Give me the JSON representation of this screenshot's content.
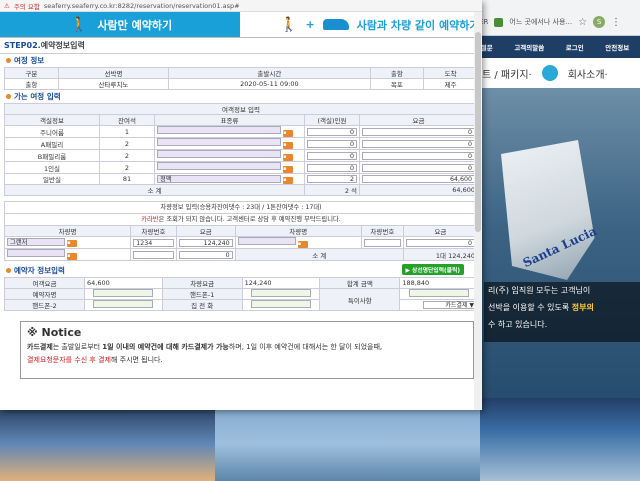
{
  "browser": {
    "warning": "주의 요함",
    "url": "seaferry.seaferry.co.kr:8282/reservation/reservation01.asp#",
    "bg_bookmarks": "AVER",
    "bg_bookmark2": "어느 곳에서나 사용...",
    "profile": "S"
  },
  "background": {
    "nav": [
      "절문",
      "고객의말씀",
      "로그인",
      "안전정보"
    ],
    "sub_left": "트 / 패키지·",
    "sub_right": "회사소개·",
    "ship_name": "Santa Lucia",
    "notice_lines": [
      "리(주) 임직원 모두는 고객님이",
      "선박을 이용할 수 있도록",
      "수 하고 있습니다."
    ],
    "notice_highlight": "정부의"
  },
  "banner": {
    "tab1": "사람만 예약하기",
    "tab2": "사람과 차량 같이 예약하기"
  },
  "step": {
    "num": "STEP02.",
    "title": "예약정보입력"
  },
  "trip": {
    "section": "여정 정보",
    "headers": [
      "구분",
      "선박명",
      "출발시간",
      "출항",
      "도착"
    ],
    "row": [
      "출항",
      "산타루치노",
      "2020-05-11 09:00",
      "목포",
      "제주"
    ]
  },
  "cabin": {
    "section": "가는 여정 입력",
    "title": "여객정보 입력",
    "headers": [
      "객실정보",
      "잔여석",
      "표종류",
      "(객실)인원",
      "요금"
    ],
    "rows": [
      {
        "name": "주니어룸",
        "rem": "1",
        "type": "",
        "cnt": "0",
        "fare": "0"
      },
      {
        "name": "A패밀리",
        "rem": "2",
        "type": "",
        "cnt": "0",
        "fare": "0"
      },
      {
        "name": "B패밀리룸",
        "rem": "2",
        "type": "",
        "cnt": "0",
        "fare": "0"
      },
      {
        "name": "1인실",
        "rem": "2",
        "type": "",
        "cnt": "0",
        "fare": "0"
      },
      {
        "name": "일반실",
        "rem": "81",
        "type": "정액",
        "cnt": "2",
        "fare": "64,600"
      }
    ],
    "subtotal_label": "소 계",
    "subtotal_cnt": "2 석",
    "subtotal_fare": "64,600"
  },
  "vehicle": {
    "title": "차량정보 입력(승용차잔여댓수 : 23대 / 1톤잔여댓수 : 17대)",
    "note_red": "카라반",
    "note": "은 조회가 되지 않습니다. 고객센터로 상담 후 예약진행 부탁드립니다.",
    "headers": [
      "차량명",
      "차량번호",
      "요금",
      "차량명",
      "차량번호",
      "요금"
    ],
    "row1": {
      "name": "그랜저",
      "num": "1234",
      "fare": "124,240",
      "name2": "",
      "num2": "",
      "fare2": "0"
    },
    "row2": {
      "name": "",
      "num": "",
      "fare": "0"
    },
    "subtotal_label": "소 계",
    "subtotal_cnt": "1대",
    "subtotal_fare": "124,240"
  },
  "booker": {
    "section": "예약자 정보입력",
    "btn": "▶ 상선명단입력(클릭)",
    "l1": "여객요금",
    "v1": "64,600",
    "l2": "차량요금",
    "v2": "124,240",
    "l3": "합계 금액",
    "v3": "188,840",
    "l4": "예약자명",
    "l5": "핸드폰-1",
    "l6": "특이사항",
    "l7": "핸드폰-2",
    "l8": "집 전 화",
    "pay": "카드결제 ▼"
  },
  "notice": {
    "title": "※ Notice",
    "b1": "카드결제",
    "t1": "는 출발일로부터 ",
    "b2": "1일 이내의 예약건에 대해 카드결제가 가능",
    "t2": "하며, 1일 이후 예약건에 대해서는 한 달이 되었을때,",
    "red": "결제요청문자를 수신 후 결제",
    "t3": "해 주시면 됩니다."
  }
}
